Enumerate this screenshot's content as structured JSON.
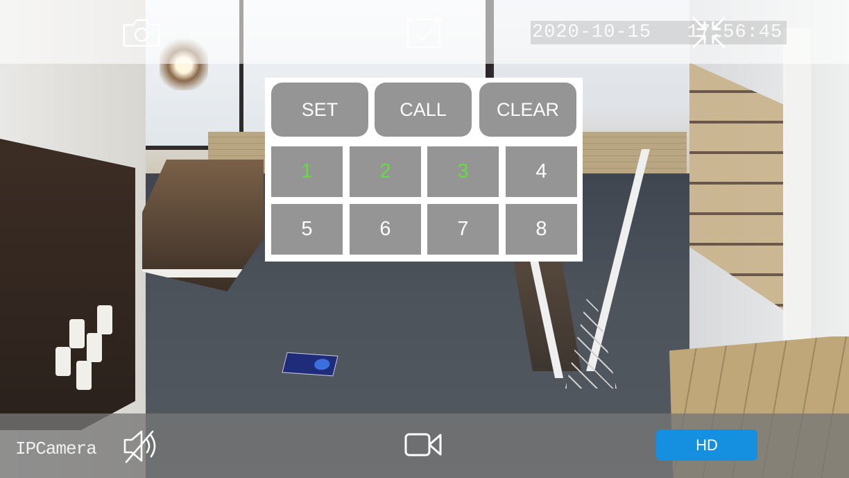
{
  "app": {
    "name": "IPCamera"
  },
  "topbar": {
    "snapshot_icon": "camera-icon",
    "record_icon": "save-check-icon",
    "collapse_icon": "exit-fullscreen-icon",
    "timestamp": "2020-10-15   17:56:45"
  },
  "keypad": {
    "actions": [
      {
        "label": "SET"
      },
      {
        "label": "CALL"
      },
      {
        "label": "CLEAR"
      }
    ],
    "presets": [
      {
        "label": "1",
        "active": true
      },
      {
        "label": "2",
        "active": true
      },
      {
        "label": "3",
        "active": true
      },
      {
        "label": "4",
        "active": false
      },
      {
        "label": "5",
        "active": false
      },
      {
        "label": "6",
        "active": false
      },
      {
        "label": "7",
        "active": false
      },
      {
        "label": "8",
        "active": false
      }
    ],
    "active_color": "#5ee03a",
    "button_color": "#959595"
  },
  "bottombar": {
    "brand": "IPCamera",
    "mute_icon": "speaker-muted-icon",
    "video_icon": "video-camera-icon",
    "quality_label": "HD",
    "quality_color": "#1590e0"
  }
}
